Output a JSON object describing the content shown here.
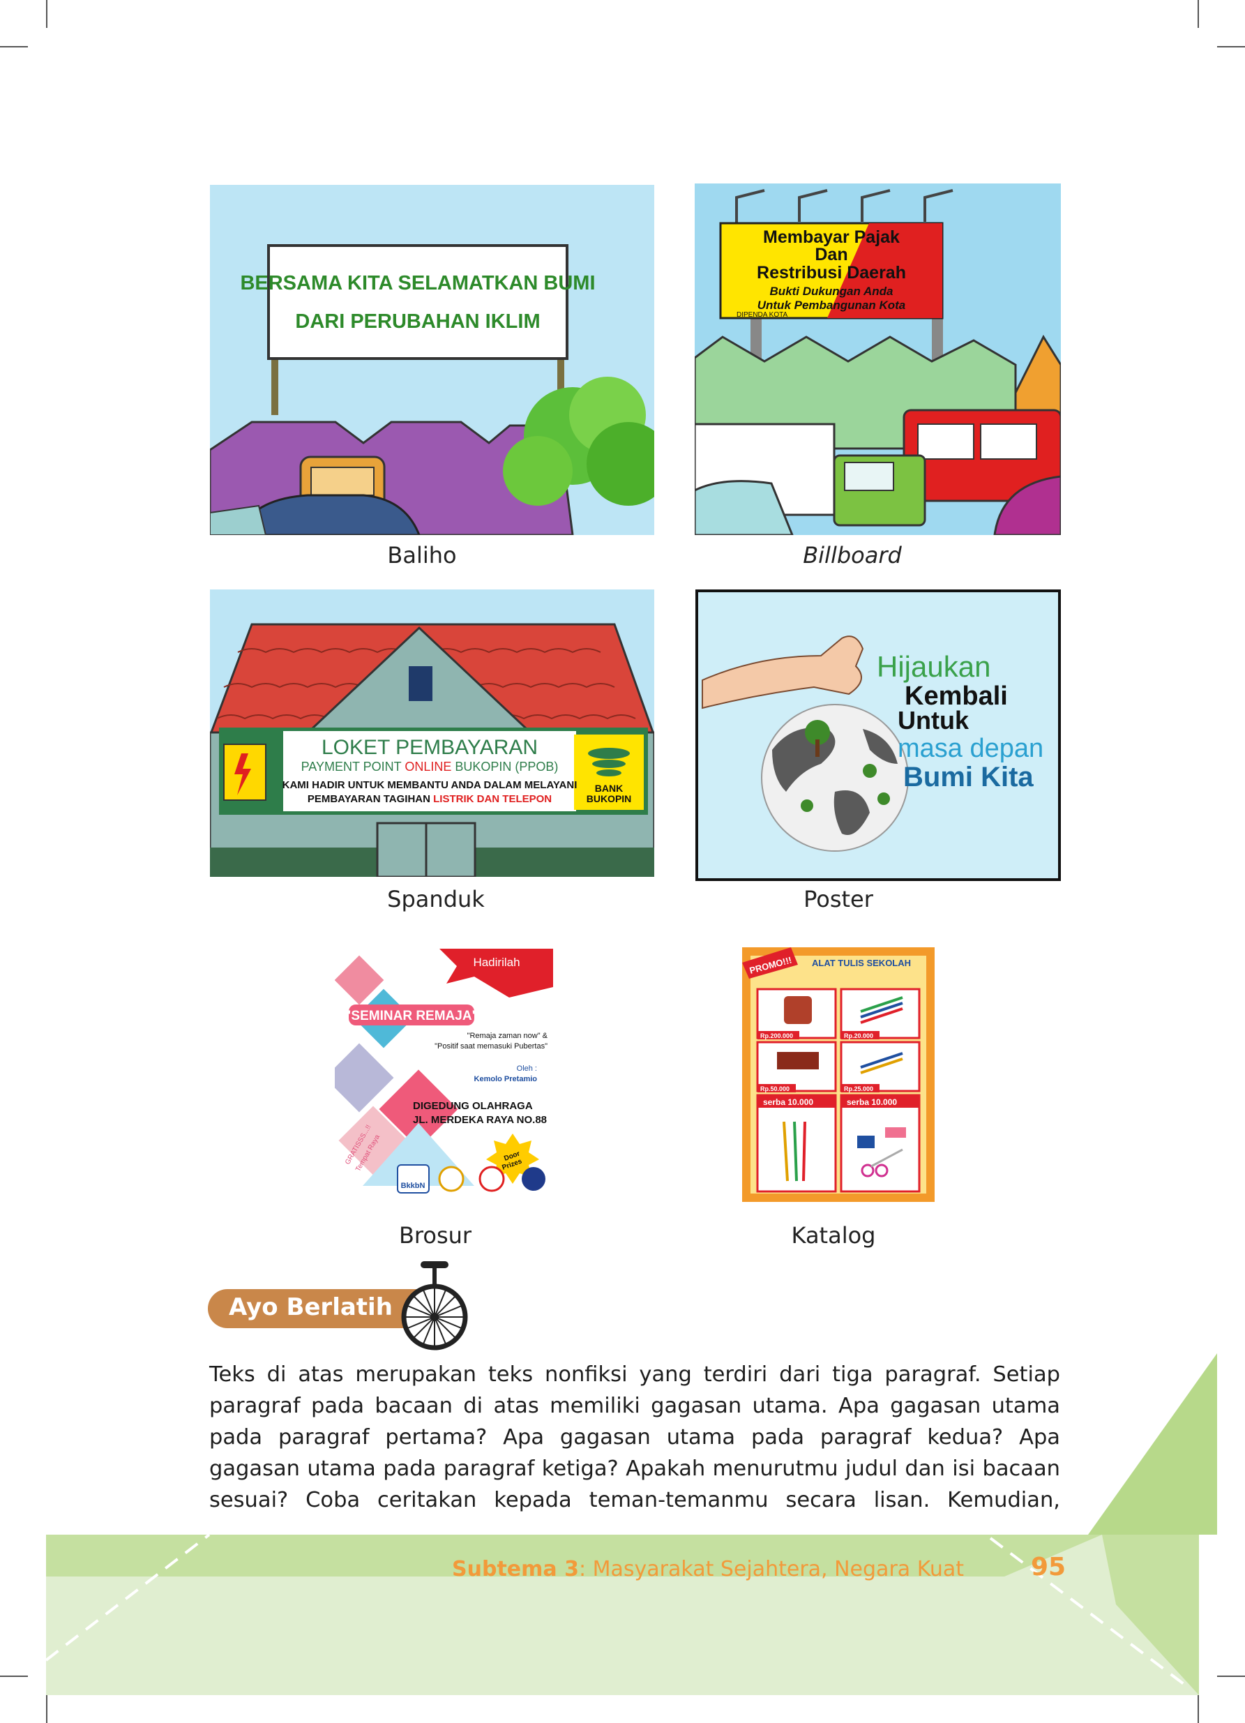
{
  "figures": {
    "baliho": {
      "caption": "Baliho",
      "sign_line1": "BERSAMA KITA SELAMATKAN BUMI",
      "sign_line2": "DARI PERUBAHAN IKLIM"
    },
    "billboard": {
      "caption": "Billboard",
      "line1": "Membayar Pajak",
      "line2": "Dan",
      "line3": "Restribusi Daerah",
      "line4": "Bukti Dukungan Anda",
      "line5": "Untuk Pembangunan Kota",
      "line6": "DIPENDA KOTA"
    },
    "spanduk": {
      "caption": "Spanduk",
      "title": "LOKET PEMBAYARAN",
      "line2a": "PAYMENT POINT ",
      "line2b": "ONLINE",
      "line2c": " BUKOPIN (PPOB)",
      "line3": "KAMI HADIR UNTUK MEMBANTU ANDA DALAM MELAYANI",
      "line4a": "PEMBAYARAN TAGIHAN ",
      "line4b": "LISTRIK DAN TELEPON",
      "bank_line1": "BANK",
      "bank_line2": "BUKOPIN"
    },
    "poster": {
      "caption": "Poster",
      "line1": "Hijaukan",
      "line2": "Kembali",
      "line3": "Untuk",
      "line4": "masa depan",
      "line5": "Bumi Kita"
    },
    "brosur": {
      "caption": "Brosur",
      "hadirilah": "Hadirilah",
      "title": "\"SEMINAR REMAJA\"",
      "sub1": "\"Remaja zaman now\" &",
      "sub2": "\"Positif saat memasuki Pubertas\"",
      "oleh": "Oleh :",
      "speaker": "Kemolo Pretamio",
      "venue1": "DIGEDUNG OLAHRAGA",
      "venue2": "JL. MERDEKA RAYA NO.88",
      "gratis": "GRATISSS...!!",
      "tempat": "Tempat Raya",
      "door1": "Door",
      "door2": "Prizes",
      "logo": "BkkbN"
    },
    "katalog": {
      "caption": "Katalog",
      "promo": "PROMO!!!",
      "title": "ALAT TULIS SEKOLAH",
      "price1": "Rp.200.000",
      "price2": "Rp.20.000",
      "price3": "Rp.50.000",
      "price4": "Rp.25.000",
      "serba1": "serba 10.000",
      "serba2": "serba 10.000"
    }
  },
  "section_label": "Ayo Berlatih",
  "body_lines": [
    "Teks di atas merupakan teks nonfiksi yang terdiri dari tiga paragraf. Setiap",
    "paragraf pada bacaan di atas memiliki gagasan utama. Apa gagasan utama",
    "pada paragraf pertama? Apa gagasan utama pada paragraf kedua? Apa",
    "gagasan utama pada paragraf ketiga? Apakah menurutmu judul dan isi bacaan",
    "sesuai? Coba ceritakan kepada teman-temanmu secara lisan. Kemudian,"
  ],
  "footer": {
    "subtema_bold": "Subtema 3",
    "subtema_rest": ": Masyarakat Sejahtera, Negara Kuat",
    "page_number": "95"
  },
  "colors": {
    "accent_orange": "#f29a3a",
    "label_brown": "#c9874a",
    "footer_green": "#c5e0a0",
    "footer_green_light": "#e0eed0"
  }
}
